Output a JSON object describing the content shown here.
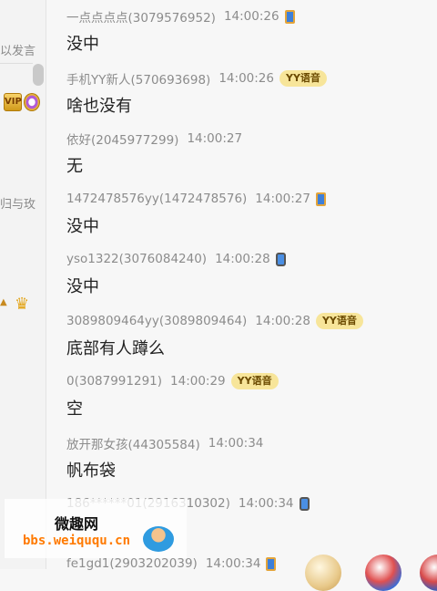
{
  "sidebar": {
    "input_hint": "以发言",
    "side_text": "归与玫"
  },
  "messages": [
    {
      "name": "一点点点点(3079576952)",
      "time": "14:00:26",
      "device": "pad",
      "badge": "",
      "text": "没中"
    },
    {
      "name": "手机YY新人(570693698)",
      "time": "14:00:26",
      "device": "",
      "badge": "YY语音",
      "text": "啥也没有"
    },
    {
      "name": "依好(2045977299)",
      "time": "14:00:27",
      "device": "",
      "badge": "",
      "text": "无"
    },
    {
      "name": "1472478576yy(1472478576)",
      "time": "14:00:27",
      "device": "pad",
      "badge": "",
      "text": "没中"
    },
    {
      "name": "yso1322(3076084240)",
      "time": "14:00:28",
      "device": "phone",
      "badge": "",
      "text": "没中"
    },
    {
      "name": "3089809464yy(3089809464)",
      "time": "14:00:28",
      "device": "",
      "badge": "YY语音",
      "text": "底部有人蹲么"
    },
    {
      "name": "0(3087991291)",
      "time": "14:00:29",
      "device": "",
      "badge": "YY语音",
      "text": "空"
    },
    {
      "name": "放开那女孩(44305584)",
      "time": "14:00:34",
      "device": "",
      "badge": "",
      "text": "帆布袋"
    },
    {
      "name": "186******01(2916310302)",
      "time": "14:00:34",
      "device": "phone",
      "badge": "",
      "text": ""
    },
    {
      "name": "fe1gd1(2903202039)",
      "time": "14:00:34",
      "device": "pad",
      "badge": "",
      "text": ""
    }
  ],
  "watermark": {
    "title": "微趣网",
    "url": "bbs.weiququ.cn"
  },
  "colors": {
    "badge_bg": "#f7e59a",
    "badge_text": "#6b4a00",
    "meta_text": "#8c8c8c",
    "watermark_url": "#ff7a00"
  }
}
